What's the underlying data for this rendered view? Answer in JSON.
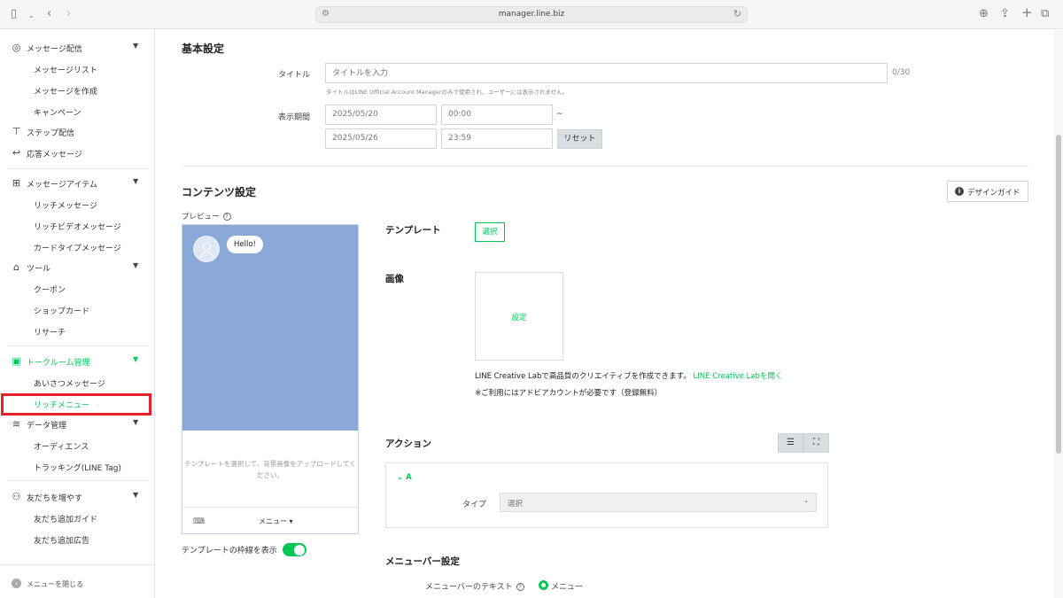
{
  "browser": {
    "url": "manager.line.biz"
  },
  "sidebar": {
    "sections": [
      {
        "label": "メッセージ配信",
        "items": [
          "メッセージリスト",
          "メッセージを作成",
          "キャンペーン"
        ]
      },
      {
        "label": "ステップ配信"
      },
      {
        "label": "応答メッセージ"
      },
      {
        "label": "メッセージアイテム",
        "items": [
          "リッチメッセージ",
          "リッチビデオメッセージ",
          "カードタイプメッセージ"
        ]
      },
      {
        "label": "ツール",
        "items": [
          "クーポン",
          "ショップカード",
          "リサーチ"
        ]
      },
      {
        "label": "トークルーム管理",
        "items": [
          "あいさつメッセージ",
          "リッチメニュー"
        ]
      },
      {
        "label": "データ管理",
        "items": [
          "オーディエンス",
          "トラッキング(LINE Tag)"
        ]
      },
      {
        "label": "友だちを増やす",
        "items": [
          "友だち追加ガイド",
          "友だち追加広告"
        ]
      }
    ],
    "footer": "メニューを閉じる",
    "active_color": "#06c755",
    "highlight_color": "#e8202a"
  },
  "basic": {
    "heading": "基本設定",
    "title_label": "タイトル",
    "title_placeholder": "タイトルを入力",
    "title_counter": "0/30",
    "title_hint": "タイトルはLINE Official Account Managerのみで使用され、ユーザーには表示されません。",
    "period_label": "表示期間",
    "start_date": "2025/05/20",
    "start_time": "00:00",
    "tilde": "~",
    "end_date": "2025/05/26",
    "end_time": "23:59",
    "reset": "リセット"
  },
  "content": {
    "heading": "コンテンツ設定",
    "design_guide": "デザインガイド",
    "preview_label": "プレビュー",
    "preview_bubble": "Hello!",
    "preview_message": "テンプレートを選択して、背景画像をアップロードしてください。",
    "preview_menu": "メニュー ▾",
    "toggle_label": "テンプレートの枠線を表示",
    "template_label": "テンプレート",
    "template_button": "選択",
    "image_label": "画像",
    "image_button": "設定",
    "creative_note": "LINE Creative Labで高品質のクリエイティブを作成できます。",
    "creative_link": "LINE Creative Labを開く",
    "account_note": "※ご利用にはアドビアカウントが必要です（登録無料）"
  },
  "action": {
    "heading": "アクション",
    "item": "A",
    "type_label": "タイプ",
    "type_value": "選択"
  },
  "menubar": {
    "heading": "メニューバー設定",
    "text_label": "メニューバーのテキスト",
    "option": "メニュー"
  }
}
